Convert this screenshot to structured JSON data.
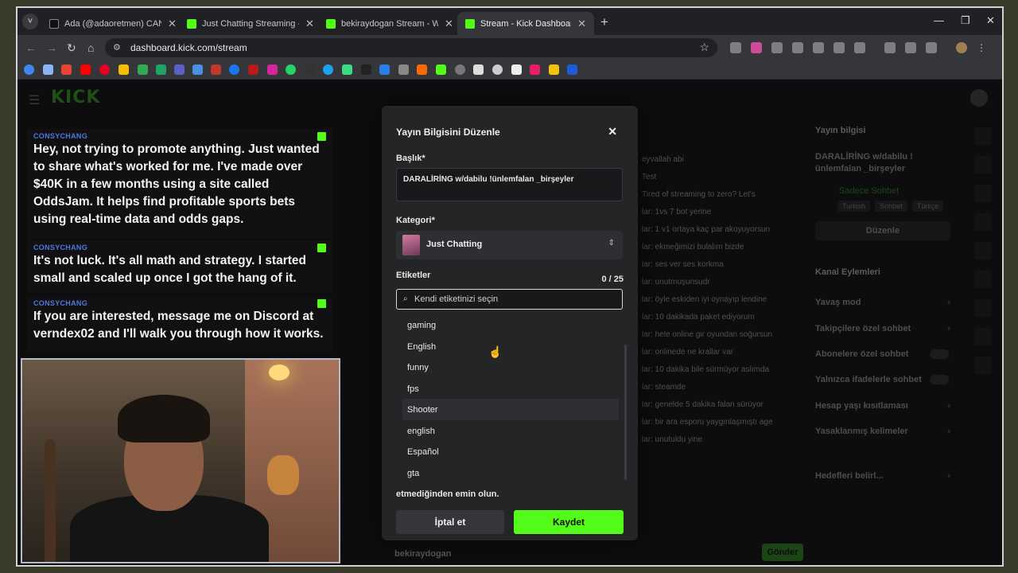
{
  "browser": {
    "tabs": [
      {
        "label": "Ada (@adaoretmen) CANLI Yayınd",
        "color": "#000000"
      },
      {
        "label": "Just Chatting Streaming - Live Stre",
        "color": "#53fc18"
      },
      {
        "label": "bekiraydogan Stream - Watch Live",
        "color": "#53fc18"
      },
      {
        "label": "Stream - Kick Dashboard",
        "color": "#53fc18"
      }
    ],
    "url": "dashboard.kick.com/stream"
  },
  "overlay_chat": [
    {
      "user": "CONSYCHANG",
      "message": "Hey, not trying to promote anything. Just wanted to share what's worked for me. I've made over $40K in a few months using a site called OddsJam. It helps find profitable sports bets using real-time data and odds gaps."
    },
    {
      "user": "CONSYCHANG",
      "message": "It's not luck. It's all math and strategy. I started small and scaled up once I got the hang of it."
    },
    {
      "user": "CONSYCHANG",
      "message": "If you are interested, message me on Discord at verndex02 and I'll walk you through how it works."
    }
  ],
  "modal": {
    "title": "Yayın Bilgisini Düzenle",
    "title_label": "Başlık*",
    "title_value": "DARALİRİNG w/dabilu !ünlemfalan _birşeyler",
    "category_label": "Kategori*",
    "category_value": "Just Chatting",
    "tags_label": "Etiketler",
    "tags_count": "0 / 25",
    "tags_placeholder": "Kendi etiketinizi seçin",
    "tag_options": [
      "gaming",
      "English",
      "funny",
      "fps",
      "Shooter",
      "english",
      "Español",
      "gta"
    ],
    "hovered_option": "Shooter",
    "warning_text": "etmediğinden emin olun.",
    "cancel_label": "İptal et",
    "save_label": "Kaydet"
  },
  "stream_info": {
    "title": "Yayın bilgisi",
    "stream_title": "DARALİRİNG w/dabilu !ünlemfalan _birşeyler",
    "category": "Sadece Sohbet",
    "tags": [
      "Turkish",
      "Sohbet",
      "Türkçe"
    ],
    "edit_label": "Düzenle"
  },
  "channel_actions": {
    "title": "Kanal Eylemleri",
    "items": [
      "Yavaş mod",
      "Takipçilere özel sohbet",
      "Abonelere özel sohbet",
      "Yalnızca ifadelerle sohbet",
      "Hesap yaşı kısıtlaması",
      "Yasaklanmış kelimeler",
      "Hedefleri belirl..."
    ]
  },
  "dashboard_chat": [
    {
      "user": "",
      "text": "eyvallah abi"
    },
    {
      "user": "",
      "text": "Test"
    },
    {
      "user": "",
      "text": "Tired of streaming to zero? Let's"
    },
    {
      "user": "",
      "text": "lar: 1vs 7 bot yerine"
    },
    {
      "user": "",
      "text": "lar: 1 v1 ortaya kaç par akoyuyorsun"
    },
    {
      "user": "",
      "text": "lar: ekmeğimizi bulalım bizde"
    },
    {
      "user": "",
      "text": "lar: ses ver ses korkma"
    },
    {
      "user": "",
      "text": "lar: unutmuşunsudr"
    },
    {
      "user": "",
      "text": "lar: öyle eskiden iyi oynayıp lendine"
    },
    {
      "user": "",
      "text": "lar: 10 dakikada paket ediyorum"
    },
    {
      "user": "",
      "text": "lar: hele online gir oyundan soğursun"
    },
    {
      "user": "",
      "text": "lar: onlinede ne krallar var"
    },
    {
      "user": "",
      "text": "lar: 10 dakika bile sürmüyor aslımda"
    },
    {
      "user": "",
      "text": "lar: steamde"
    },
    {
      "user": "",
      "text": "lar: genelde 5 dakika falan sürüyor"
    },
    {
      "user": "",
      "text": "lar: bir ara esporu yaygınlaşmıştı age"
    },
    {
      "user": "",
      "text": "lar: unutuldu yine"
    }
  ],
  "footer": {
    "username": "bekiraydogan",
    "send_label": "Gönder"
  }
}
